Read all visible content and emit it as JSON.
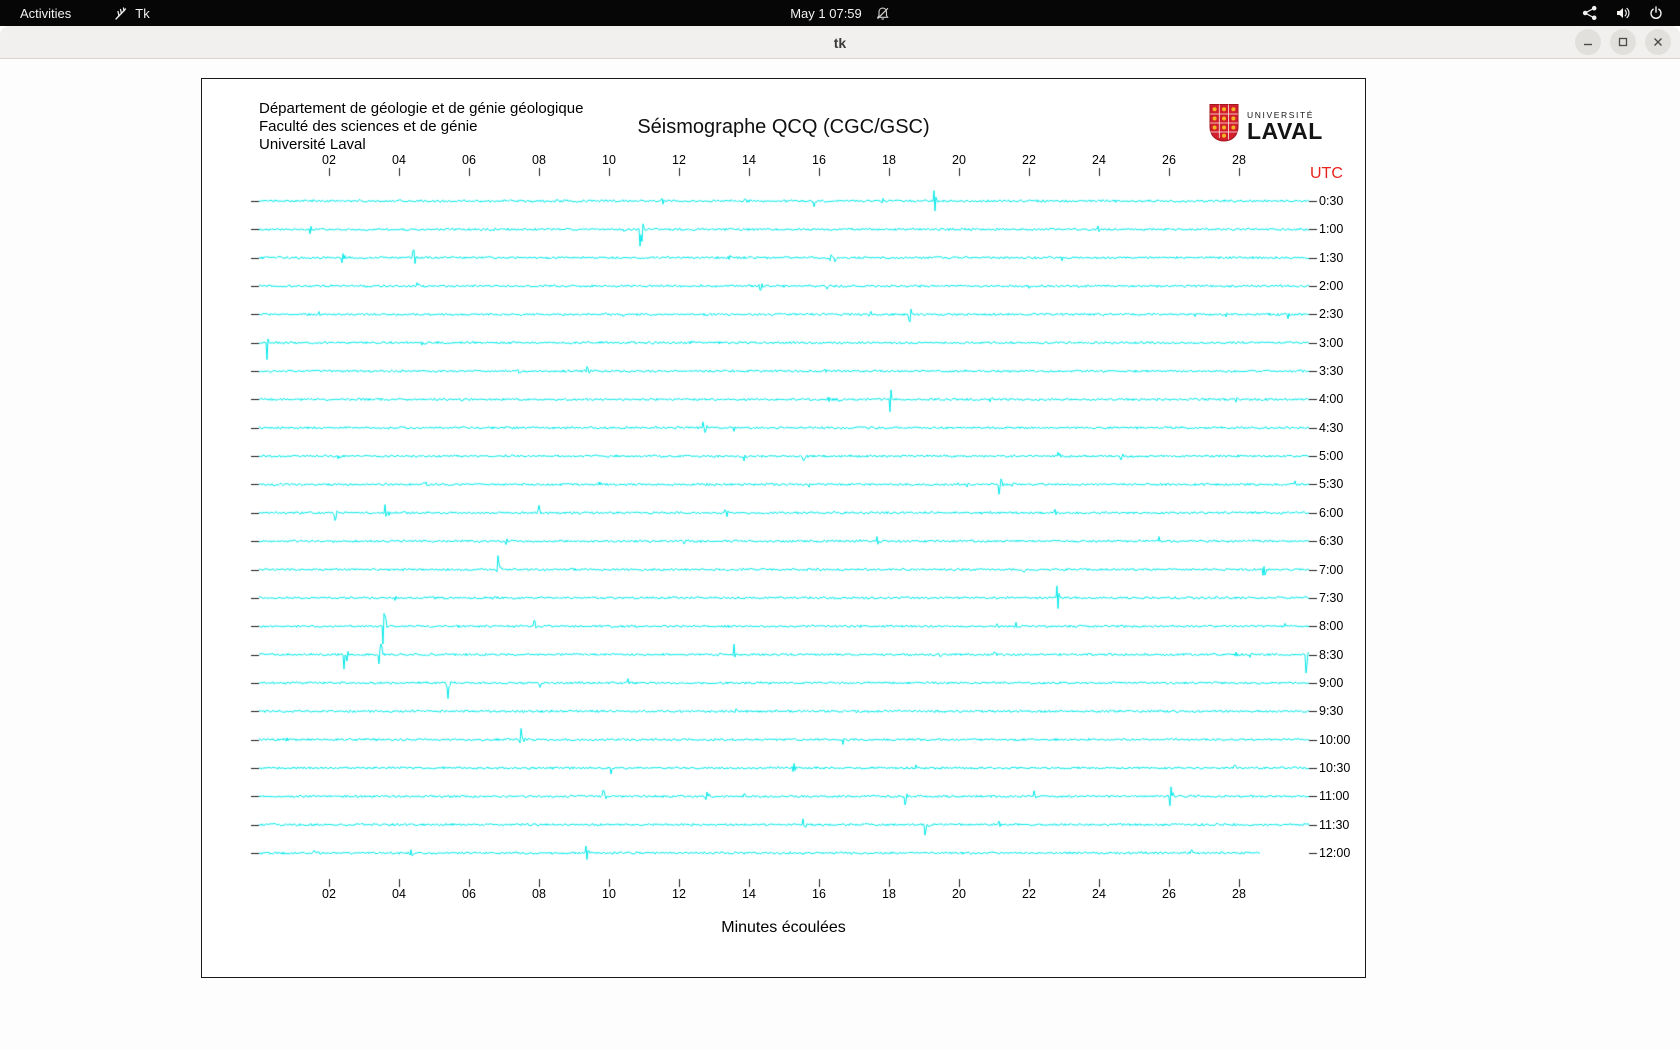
{
  "topbar": {
    "activities_label": "Activities",
    "app_name": "Tk",
    "clock": "May 1  07:59"
  },
  "window": {
    "title": "tk"
  },
  "seismograph": {
    "header_lines": [
      "Département de géologie et de génie géologique",
      "Faculté des sciences et de génie",
      "Université Laval"
    ],
    "title": "Séismographe QCQ (CGC/GSC)",
    "logo": {
      "top": "UNIVERSITÉ",
      "bottom": "LAVAL"
    },
    "utc_label": "UTC",
    "x_axis_label": "Minutes écoulées",
    "trace_color": "#00e8e8",
    "x_ticks": [
      "02",
      "04",
      "06",
      "08",
      "10",
      "12",
      "14",
      "16",
      "18",
      "20",
      "22",
      "24",
      "26",
      "28"
    ],
    "row_labels": [
      "0:30",
      "1:00",
      "1:30",
      "2:00",
      "2:30",
      "3:00",
      "3:30",
      "4:00",
      "4:30",
      "5:00",
      "5:30",
      "6:00",
      "6:30",
      "7:00",
      "7:30",
      "8:00",
      "8:30",
      "9:00",
      "9:30",
      "10:00",
      "10:30",
      "11:00",
      "11:30",
      "12:00"
    ],
    "chart_data": {
      "type": "line",
      "x_range_minutes": [
        0,
        30
      ],
      "rows": 24,
      "row_duration_minutes": 30,
      "first_row_end_utc": "0:30",
      "last_row_end_utc": "12:00",
      "last_row_end_minute": 28.6,
      "signal": "ambient seismic noise traces with sporadic transient spikes"
    }
  }
}
